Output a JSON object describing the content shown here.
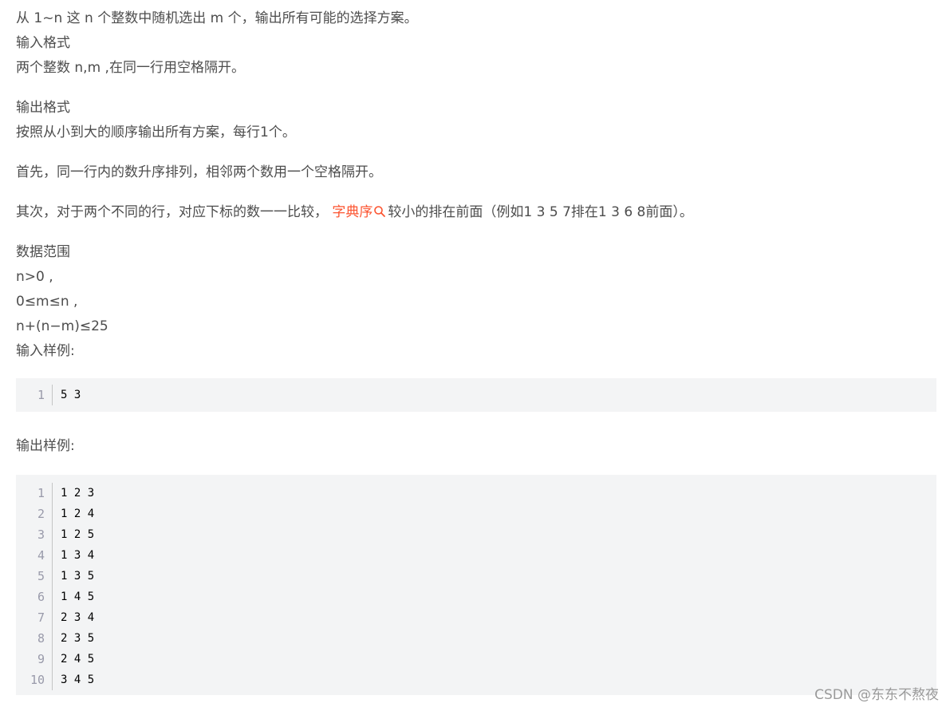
{
  "problem": {
    "statement": "从 1~n 这 n 个整数中随机选出 m 个，输出所有可能的选择方案。",
    "input_format_title": "输入格式",
    "input_format_text": "两个整数 n,m ,在同一行用空格隔开。",
    "output_format_title": "输出格式",
    "output_format_text": "按照从小到大的顺序输出所有方案，每行1个。",
    "order_rule_1": "首先，同一行内的数升序排列，相邻两个数用一个空格隔开。",
    "order_rule_2_before": "其次，对于两个不同的行，对应下标的数一一比较，",
    "order_rule_2_link": "字典序",
    "order_rule_2_after": "较小的排在前面（例如1 3 5 7排在1 3 6 8前面）。",
    "range_title": "数据范围",
    "range_1": "n>0 ,",
    "range_2": "0≤m≤n ,",
    "range_3": "n+(n−m)≤25",
    "sample_input_title": "输入样例:",
    "sample_output_title": "输出样例:"
  },
  "sample_input": {
    "line_numbers": [
      "1"
    ],
    "lines": [
      "5 3"
    ]
  },
  "sample_output": {
    "line_numbers": [
      "1",
      "2",
      "3",
      "4",
      "5",
      "6",
      "7",
      "8",
      "9",
      "10"
    ],
    "lines": [
      "1 2 3",
      "1 2 4",
      "1 2 5",
      "1 3 4",
      "1 3 5",
      "1 4 5",
      "2 3 4",
      "2 3 5",
      "2 4 5",
      "3 4 5"
    ]
  },
  "watermark": "CSDN @东东不熬夜",
  "colors": {
    "text": "#4d4d4d",
    "link": "#fc5531",
    "code_bg": "#f3f4f5"
  }
}
